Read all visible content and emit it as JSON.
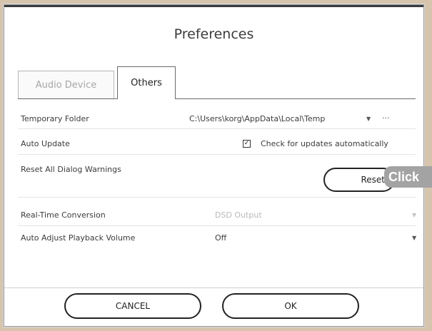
{
  "dialog": {
    "title": "Preferences"
  },
  "tabs": [
    {
      "label": "Audio Device",
      "active": false
    },
    {
      "label": "Others",
      "active": true
    }
  ],
  "settings": {
    "temporary_folder": {
      "label": "Temporary Folder",
      "value": "C:\\Users\\korg\\AppData\\Local\\Temp",
      "browse_label": "···"
    },
    "auto_update": {
      "label": "Auto Update",
      "checkbox_label": "Check for updates automatically",
      "checked": true
    },
    "reset_warnings": {
      "label": "Reset All Dialog Warnings",
      "button_label": "Reset"
    },
    "realtime_conversion": {
      "label": "Real-Time Conversion",
      "value": "DSD Output",
      "disabled": true
    },
    "auto_adjust_volume": {
      "label": "Auto Adjust Playback Volume",
      "value": "Off"
    }
  },
  "overlay": {
    "click_hint": "Click"
  },
  "buttons": {
    "cancel": "CANCEL",
    "ok": "OK"
  },
  "icons": {
    "dropdown": "chevron-down-icon",
    "checkbox_check": "check-icon"
  },
  "colors": {
    "text": "#3c3c3c",
    "disabled_text": "#b9b9b9",
    "click_badge": "#a3a3a3"
  }
}
